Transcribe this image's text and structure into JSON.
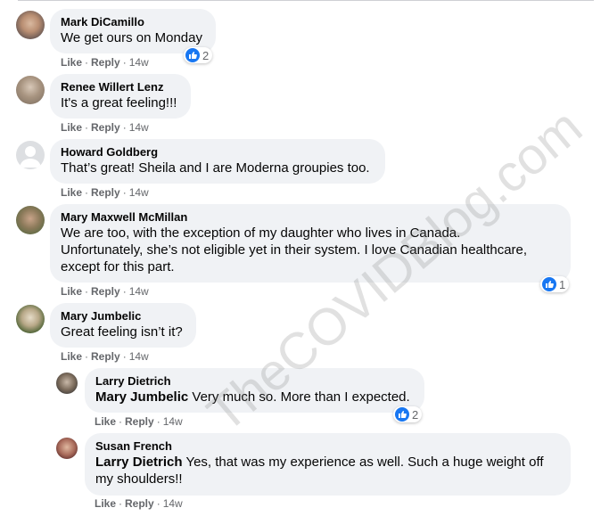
{
  "comments": [
    {
      "author": "Mark DiCamillo",
      "text": "We get ours on Monday",
      "like": "Like",
      "reply": "Reply",
      "time": "14w",
      "reactions": "2"
    },
    {
      "author": "Renee Willert Lenz",
      "text": "It's a great feeling!!!",
      "like": "Like",
      "reply": "Reply",
      "time": "14w"
    },
    {
      "author": "Howard Goldberg",
      "text": "That’s great! Sheila and I are Moderna groupies too.",
      "like": "Like",
      "reply": "Reply",
      "time": "14w"
    },
    {
      "author": "Mary Maxwell McMillan",
      "text": "We are too, with the exception of my daughter who lives in Canada.\nUnfortunately, she’s not eligible yet in their system. I love Canadian healthcare,\nexcept for this part.",
      "like": "Like",
      "reply": "Reply",
      "time": "14w",
      "reactions": "1"
    },
    {
      "author": "Mary Jumbelic",
      "text": "Great feeling isn’t it?",
      "like": "Like",
      "reply": "Reply",
      "time": "14w"
    },
    {
      "author": "Larry Dietrich",
      "mention": "Mary Jumbelic",
      "text": " Very much so. More than I expected.",
      "like": "Like",
      "reply": "Reply",
      "time": "14w",
      "reactions": "2"
    },
    {
      "author": "Susan French",
      "mention": "Larry Dietrich",
      "text": " Yes, that was my experience as well. Such a huge weight off\nmy shoulders!!",
      "like": "Like",
      "reply": "Reply",
      "time": "14w"
    }
  ],
  "watermark": "TheCOVIDBlog.com",
  "colors": {
    "bubble": "#f0f2f5",
    "meta": "#65676b",
    "like_blue": "#1877f2"
  }
}
